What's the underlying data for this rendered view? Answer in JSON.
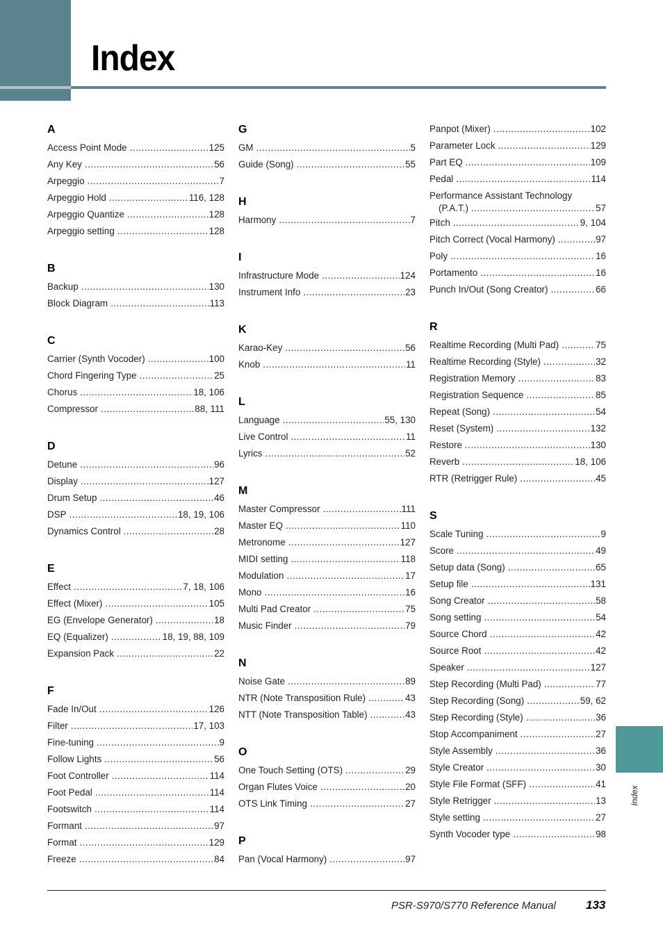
{
  "header": {
    "title": "Index"
  },
  "side_tab": {
    "label": "Index",
    "color": "#4d9a99"
  },
  "accent_color": "#5a838e",
  "columns": [
    [
      {
        "letter": "A",
        "entries": [
          {
            "term": "Access Point Mode",
            "pages": "125"
          },
          {
            "term": "Any Key",
            "pages": "56"
          },
          {
            "term": "Arpeggio",
            "pages": "7"
          },
          {
            "term": "Arpeggio Hold",
            "pages": "116, 128"
          },
          {
            "term": "Arpeggio Quantize",
            "pages": "128"
          },
          {
            "term": "Arpeggio setting",
            "pages": "128"
          }
        ]
      },
      {
        "letter": "B",
        "entries": [
          {
            "term": "Backup",
            "pages": "130"
          },
          {
            "term": "Block Diagram",
            "pages": "113"
          }
        ]
      },
      {
        "letter": "C",
        "entries": [
          {
            "term": "Carrier (Synth Vocoder)",
            "pages": "100"
          },
          {
            "term": "Chord Fingering Type",
            "pages": "25"
          },
          {
            "term": "Chorus",
            "pages": "18, 106"
          },
          {
            "term": "Compressor",
            "pages": "88, 111"
          }
        ]
      },
      {
        "letter": "D",
        "entries": [
          {
            "term": "Detune",
            "pages": "96"
          },
          {
            "term": "Display",
            "pages": "127"
          },
          {
            "term": "Drum Setup",
            "pages": "46"
          },
          {
            "term": "DSP",
            "pages": "18, 19, 106"
          },
          {
            "term": "Dynamics Control",
            "pages": "28"
          }
        ]
      },
      {
        "letter": "E",
        "entries": [
          {
            "term": "Effect",
            "pages": "7, 18, 106"
          },
          {
            "term": "Effect (Mixer)",
            "pages": "105"
          },
          {
            "term": "EG (Envelope Generator)",
            "pages": "18"
          },
          {
            "term": "EQ (Equalizer)",
            "pages": "18, 19, 88, 109"
          },
          {
            "term": "Expansion Pack",
            "pages": "22"
          }
        ]
      },
      {
        "letter": "F",
        "entries": [
          {
            "term": "Fade In/Out",
            "pages": "126"
          },
          {
            "term": "Filter",
            "pages": "17, 103"
          },
          {
            "term": "Fine-tuning",
            "pages": "9"
          },
          {
            "term": "Follow Lights",
            "pages": "56"
          },
          {
            "term": "Foot Controller",
            "pages": "114"
          },
          {
            "term": "Foot Pedal",
            "pages": "114"
          },
          {
            "term": "Footswitch",
            "pages": "114"
          },
          {
            "term": "Formant",
            "pages": "97"
          },
          {
            "term": "Format",
            "pages": "129"
          },
          {
            "term": "Freeze",
            "pages": "84"
          }
        ]
      }
    ],
    [
      {
        "letter": "G",
        "entries": [
          {
            "term": "GM",
            "pages": "5"
          },
          {
            "term": "Guide (Song)",
            "pages": "55"
          }
        ]
      },
      {
        "letter": "H",
        "entries": [
          {
            "term": "Harmony",
            "pages": "7"
          }
        ]
      },
      {
        "letter": "I",
        "entries": [
          {
            "term": "Infrastructure Mode",
            "pages": "124"
          },
          {
            "term": "Instrument Info",
            "pages": "23"
          }
        ]
      },
      {
        "letter": "K",
        "entries": [
          {
            "term": "Karao-Key",
            "pages": "56"
          },
          {
            "term": "Knob",
            "pages": "11"
          }
        ]
      },
      {
        "letter": "L",
        "entries": [
          {
            "term": "Language",
            "pages": "55, 130"
          },
          {
            "term": "Live Control",
            "pages": "11"
          },
          {
            "term": "Lyrics",
            "pages": "52"
          }
        ]
      },
      {
        "letter": "M",
        "entries": [
          {
            "term": "Master Compressor",
            "pages": "111"
          },
          {
            "term": "Master EQ",
            "pages": "110"
          },
          {
            "term": "Metronome",
            "pages": "127"
          },
          {
            "term": "MIDI setting",
            "pages": "118"
          },
          {
            "term": "Modulation",
            "pages": "17"
          },
          {
            "term": "Mono",
            "pages": "16"
          },
          {
            "term": "Multi Pad Creator",
            "pages": "75"
          },
          {
            "term": "Music Finder",
            "pages": "79"
          }
        ]
      },
      {
        "letter": "N",
        "entries": [
          {
            "term": "Noise Gate",
            "pages": "89"
          },
          {
            "term": "NTR (Note Transposition Rule)",
            "pages": "43"
          },
          {
            "term": "NTT (Note Transposition Table)",
            "pages": "43"
          }
        ]
      },
      {
        "letter": "O",
        "entries": [
          {
            "term": "One Touch Setting (OTS)",
            "pages": "29"
          },
          {
            "term": "Organ Flutes Voice",
            "pages": "20"
          },
          {
            "term": "OTS Link Timing",
            "pages": "27"
          }
        ]
      },
      {
        "letter": "P",
        "entries": [
          {
            "term": "Pan (Vocal Harmony)",
            "pages": "97"
          }
        ]
      }
    ],
    [
      {
        "letter": "",
        "entries": [
          {
            "term": "Panpot (Mixer)",
            "pages": "102"
          },
          {
            "term": "Parameter Lock",
            "pages": "129"
          },
          {
            "term": "Part EQ",
            "pages": "109"
          },
          {
            "term": "Pedal",
            "pages": "114"
          },
          {
            "term": "Performance Assistant Technology",
            "term2": "(P.A.T.)",
            "pages": "57"
          },
          {
            "term": "Pitch",
            "pages": "9, 104"
          },
          {
            "term": "Pitch Correct (Vocal Harmony)",
            "pages": "97"
          },
          {
            "term": "Poly",
            "pages": "16"
          },
          {
            "term": "Portamento",
            "pages": "16"
          },
          {
            "term": "Punch In/Out (Song Creator)",
            "pages": "66"
          }
        ]
      },
      {
        "letter": "R",
        "entries": [
          {
            "term": "Realtime Recording (Multi Pad)",
            "pages": "75"
          },
          {
            "term": "Realtime Recording (Style)",
            "pages": "32"
          },
          {
            "term": "Registration Memory",
            "pages": "83"
          },
          {
            "term": "Registration Sequence",
            "pages": "85"
          },
          {
            "term": "Repeat (Song)",
            "pages": "54"
          },
          {
            "term": "Reset (System)",
            "pages": "132"
          },
          {
            "term": "Restore",
            "pages": "130"
          },
          {
            "term": "Reverb",
            "pages": "18, 106"
          },
          {
            "term": "RTR (Retrigger Rule)",
            "pages": "45"
          }
        ]
      },
      {
        "letter": "S",
        "entries": [
          {
            "term": "Scale Tuning",
            "pages": "9"
          },
          {
            "term": "Score",
            "pages": "49"
          },
          {
            "term": "Setup data (Song)",
            "pages": "65"
          },
          {
            "term": "Setup file",
            "pages": "131"
          },
          {
            "term": "Song Creator",
            "pages": "58"
          },
          {
            "term": "Song setting",
            "pages": "54"
          },
          {
            "term": "Source Chord",
            "pages": "42"
          },
          {
            "term": "Source Root",
            "pages": "42"
          },
          {
            "term": "Speaker",
            "pages": "127"
          },
          {
            "term": "Step Recording (Multi Pad)",
            "pages": "77"
          },
          {
            "term": "Step Recording (Song)",
            "pages": "59, 62"
          },
          {
            "term": "Step Recording (Style)",
            "pages": "36"
          },
          {
            "term": "Stop Accompaniment",
            "pages": "27"
          },
          {
            "term": "Style Assembly",
            "pages": "36"
          },
          {
            "term": "Style Creator",
            "pages": "30"
          },
          {
            "term": "Style File Format (SFF)",
            "pages": "41"
          },
          {
            "term": "Style Retrigger",
            "pages": "13"
          },
          {
            "term": "Style setting",
            "pages": "27"
          },
          {
            "term": "Synth Vocoder type",
            "pages": "98"
          }
        ]
      }
    ]
  ],
  "footer": {
    "manual": "PSR-S970/S770 Reference Manual",
    "page_number": "133"
  }
}
